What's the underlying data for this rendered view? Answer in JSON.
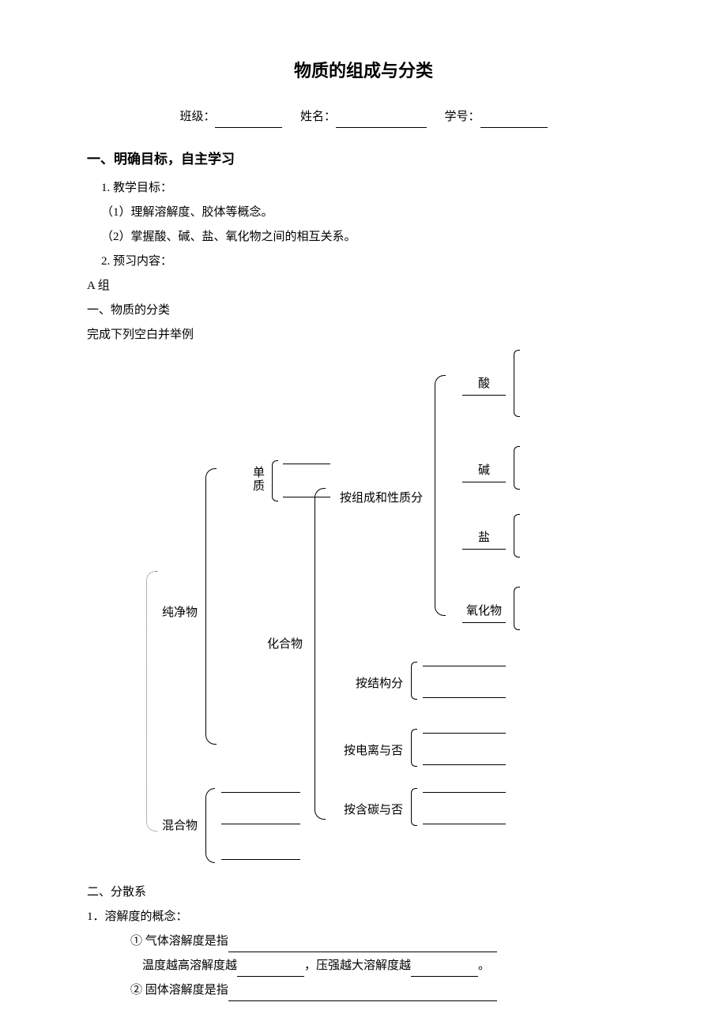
{
  "title": "物质的组成与分类",
  "form": {
    "class_label": "班级：",
    "name_label": "姓名：",
    "id_label": "学号："
  },
  "sec1_h": "一、明确目标，自主学习",
  "goals_h": "1. 教学目标：",
  "goal1": "（1）理解溶解度、胶体等概念。",
  "goal2": "（2）掌握酸、碱、盐、氧化物之间的相互关系。",
  "preview_h": "2. 预习内容：",
  "group_a": "A 组",
  "sub1": "一、物质的分类",
  "sub1_desc": "完成下列空白并举例",
  "diagram": {
    "pure": "纯净物",
    "mixture": "混合物",
    "simple": "单质",
    "compound": "化合物",
    "by_comp": "按组成和性质分",
    "by_struct": "按结构分",
    "by_ionize": "按电离与否",
    "by_carbon": "按含碳与否",
    "acid": "酸",
    "base": "碱",
    "salt": "盐",
    "oxide": "氧化物"
  },
  "sub2": "二、分散系",
  "sub2_q1": "1．溶解度的概念：",
  "q1_line1_a": "① 气体溶解度是指",
  "q1_line2_a": "温度越高溶解度越",
  "q1_line2_b": "，压强越大溶解度越",
  "q1_line2_c": "。",
  "q2_line_a": "② 固体溶解度是指"
}
